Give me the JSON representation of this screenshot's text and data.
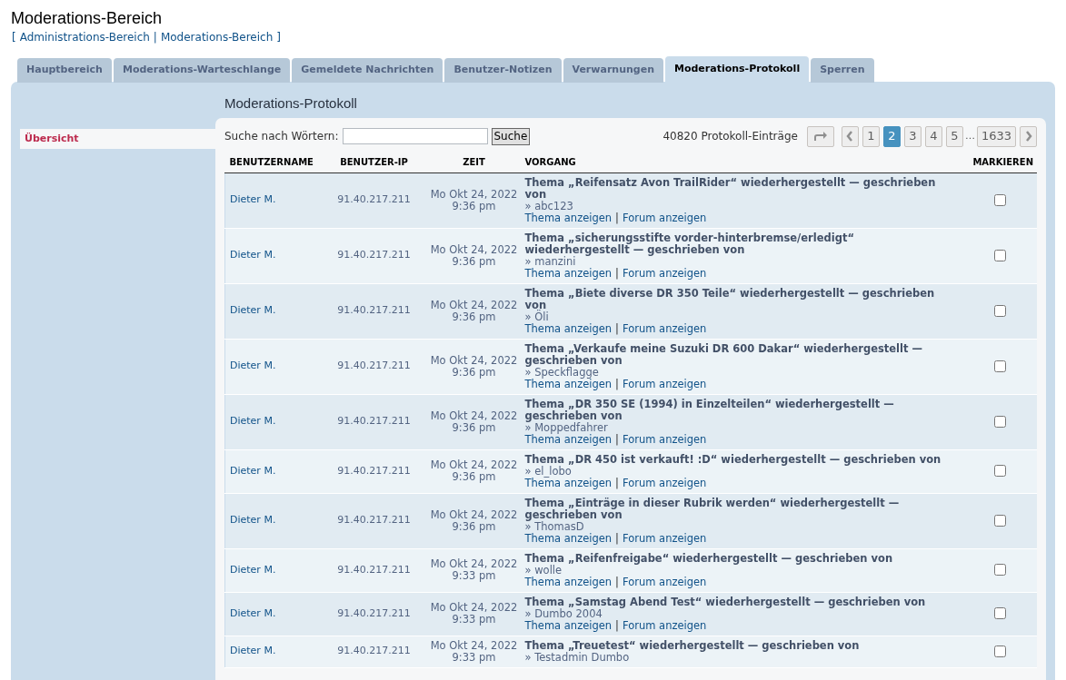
{
  "page_title": "Moderations-Bereich",
  "breadcrumb": {
    "open": "[",
    "close": "]",
    "separator": "|",
    "links": [
      "Administrations-Bereich",
      "Moderations-Bereich"
    ]
  },
  "tabs": [
    {
      "label": "Hauptbereich",
      "selected": false
    },
    {
      "label": "Moderations-Warteschlange",
      "selected": false
    },
    {
      "label": "Gemeldete Nachrichten",
      "selected": false
    },
    {
      "label": "Benutzer-Notizen",
      "selected": false
    },
    {
      "label": "Verwarnungen",
      "selected": false
    },
    {
      "label": "Moderations-Protokoll",
      "selected": true
    },
    {
      "label": "Sperren",
      "selected": false
    }
  ],
  "sidebar": {
    "items": [
      {
        "label": "Übersicht",
        "selected": true
      }
    ]
  },
  "heading": "Moderations-Protokoll",
  "search": {
    "label": "Suche nach Wörtern:",
    "button": "Suche"
  },
  "entry_count": "40820 Protokoll-Einträge",
  "pagination": {
    "pages": [
      {
        "label": "1",
        "selected": false
      },
      {
        "label": "2",
        "selected": true
      },
      {
        "label": "3",
        "selected": false
      },
      {
        "label": "4",
        "selected": false
      },
      {
        "label": "5",
        "selected": false
      },
      {
        "label": "1633",
        "selected": false
      }
    ],
    "ellipsis": "…"
  },
  "table": {
    "columns": [
      "BENUTZERNAME",
      "BENUTZER-IP",
      "ZEIT",
      "VORGANG",
      "MARKIEREN"
    ],
    "link_separator": "|",
    "rows": [
      {
        "user": "Dieter M.",
        "ip": "91.40.217.211",
        "date": "Mo Okt 24, 2022",
        "time": "9:36 pm",
        "title": "Thema „Reifensatz Avon TrailRider“ wiederhergestellt — geschrieben von",
        "author": "» abc123",
        "links": [
          "Thema anzeigen",
          "Forum anzeigen"
        ],
        "checked": false
      },
      {
        "user": "Dieter M.",
        "ip": "91.40.217.211",
        "date": "Mo Okt 24, 2022",
        "time": "9:36 pm",
        "title": "Thema „sicherungsstifte vorder-hinterbremse/erledigt“ wiederhergestellt — geschrieben von",
        "author": "» manzini",
        "links": [
          "Thema anzeigen",
          "Forum anzeigen"
        ],
        "checked": false
      },
      {
        "user": "Dieter M.",
        "ip": "91.40.217.211",
        "date": "Mo Okt 24, 2022",
        "time": "9:36 pm",
        "title": "Thema „Biete diverse DR 350 Teile“ wiederhergestellt — geschrieben von",
        "author": "» Öli",
        "links": [
          "Thema anzeigen",
          "Forum anzeigen"
        ],
        "checked": false
      },
      {
        "user": "Dieter M.",
        "ip": "91.40.217.211",
        "date": "Mo Okt 24, 2022",
        "time": "9:36 pm",
        "title": "Thema „Verkaufe meine Suzuki DR 600 Dakar“ wiederhergestellt — geschrieben von",
        "author": "» Speckflagge",
        "links": [
          "Thema anzeigen",
          "Forum anzeigen"
        ],
        "checked": false
      },
      {
        "user": "Dieter M.",
        "ip": "91.40.217.211",
        "date": "Mo Okt 24, 2022",
        "time": "9:36 pm",
        "title": "Thema „DR 350 SE (1994) in Einzelteilen“ wiederhergestellt — geschrieben von",
        "author": "» Moppedfahrer",
        "links": [
          "Thema anzeigen",
          "Forum anzeigen"
        ],
        "checked": false
      },
      {
        "user": "Dieter M.",
        "ip": "91.40.217.211",
        "date": "Mo Okt 24, 2022",
        "time": "9:36 pm",
        "title": "Thema „DR 450 ist verkauft! :D“ wiederhergestellt — geschrieben von",
        "author": "» el_lobo",
        "links": [
          "Thema anzeigen",
          "Forum anzeigen"
        ],
        "checked": false
      },
      {
        "user": "Dieter M.",
        "ip": "91.40.217.211",
        "date": "Mo Okt 24, 2022",
        "time": "9:36 pm",
        "title": "Thema „Einträge in dieser Rubrik werden“ wiederhergestellt — geschrieben von",
        "author": "» ThomasD",
        "links": [
          "Thema anzeigen",
          "Forum anzeigen"
        ],
        "checked": false
      },
      {
        "user": "Dieter M.",
        "ip": "91.40.217.211",
        "date": "Mo Okt 24, 2022",
        "time": "9:33 pm",
        "title": "Thema „Reifenfreigabe“ wiederhergestellt — geschrieben von",
        "author": "» wolle",
        "links": [
          "Thema anzeigen",
          "Forum anzeigen"
        ],
        "checked": false
      },
      {
        "user": "Dieter M.",
        "ip": "91.40.217.211",
        "date": "Mo Okt 24, 2022",
        "time": "9:33 pm",
        "title": "Thema „Samstag Abend Test“ wiederhergestellt — geschrieben von",
        "author": "» Dumbo 2004",
        "links": [
          "Thema anzeigen",
          "Forum anzeigen"
        ],
        "checked": false
      },
      {
        "user": "Dieter M.",
        "ip": "91.40.217.211",
        "date": "Mo Okt 24, 2022",
        "time": "9:33 pm",
        "title": "Thema „Treuetest“ wiederhergestellt — geschrieben von",
        "author": "» Testadmin Dumbo",
        "checked": false
      }
    ]
  }
}
